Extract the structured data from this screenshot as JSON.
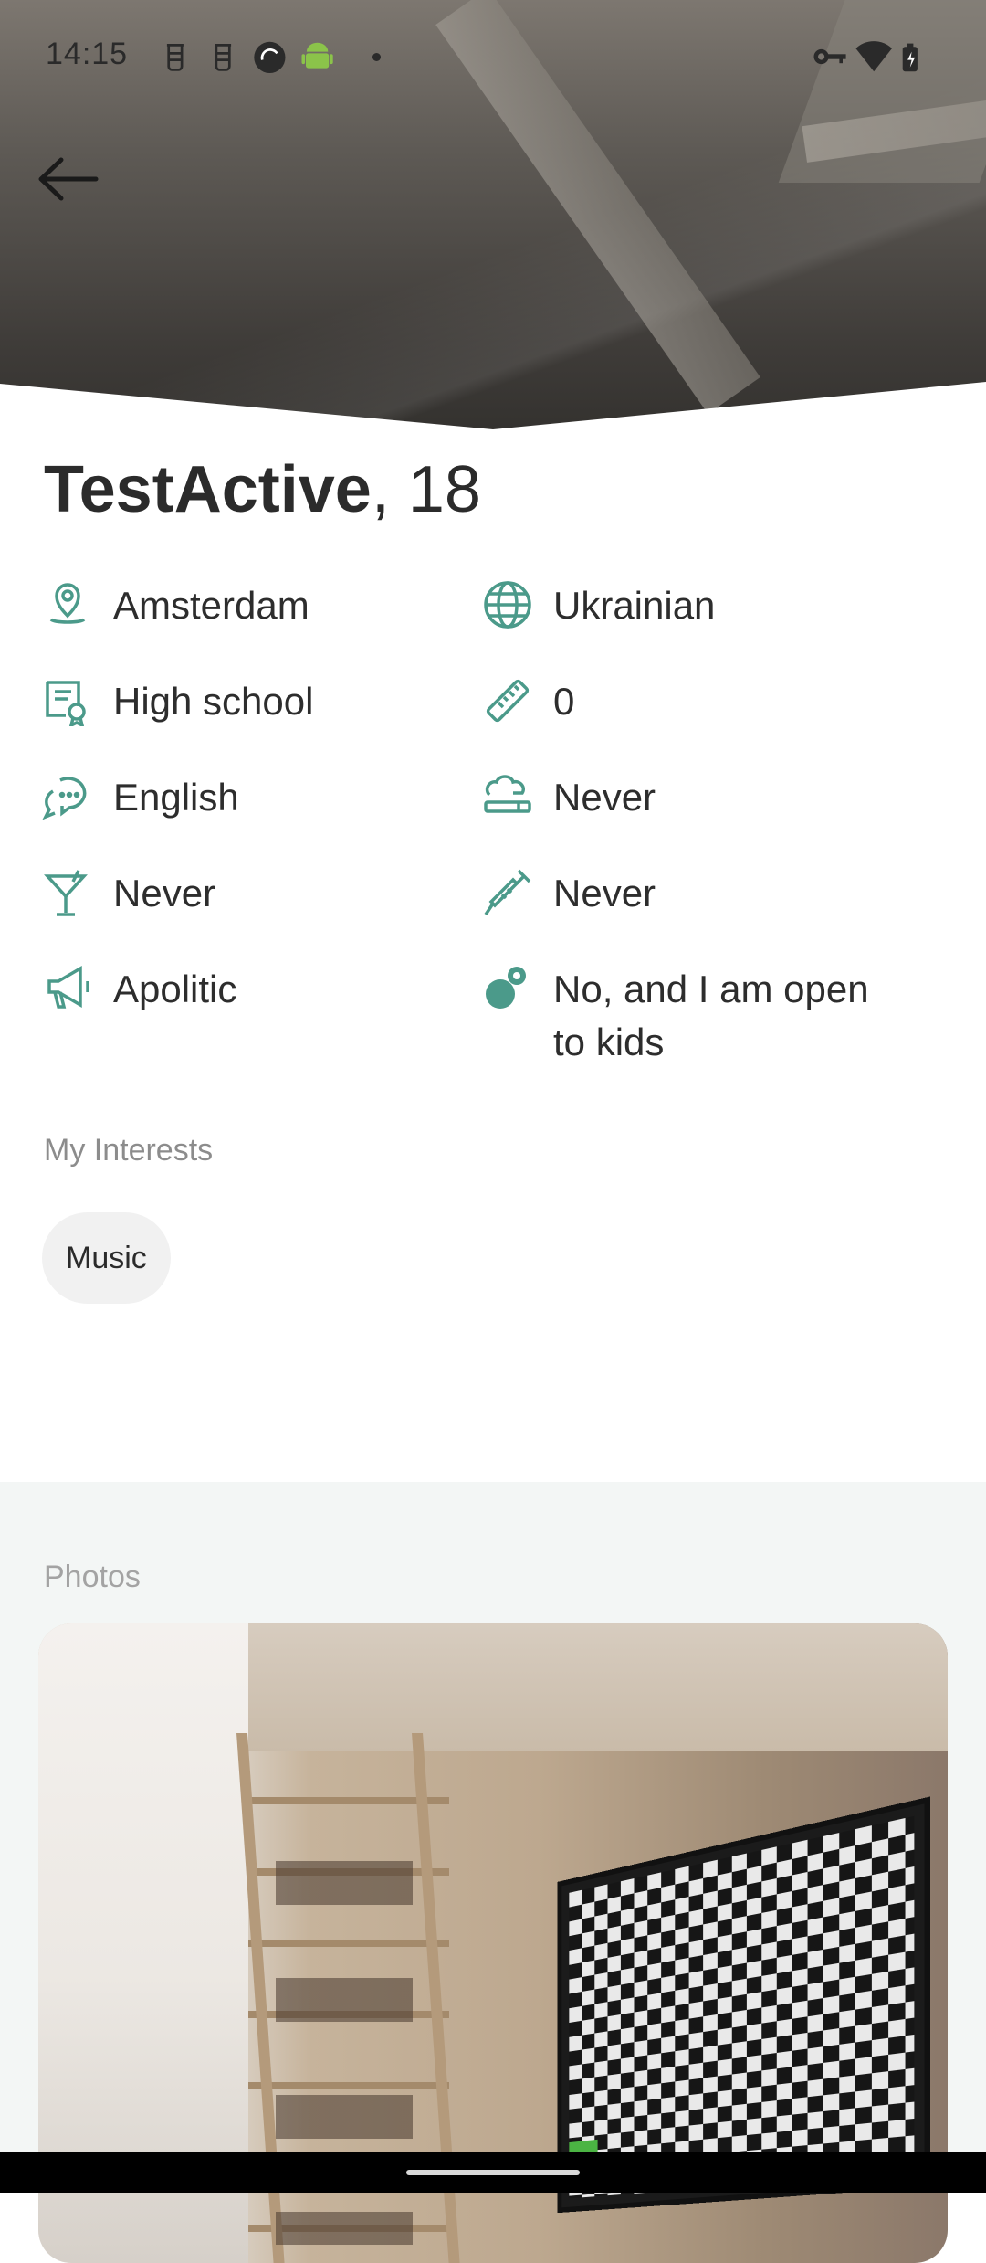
{
  "status_bar": {
    "time": "14:15"
  },
  "profile": {
    "name": "TestActive",
    "age_suffix": ", 18"
  },
  "attributes": [
    {
      "icon": "location-pin-icon",
      "label": "Amsterdam"
    },
    {
      "icon": "globe-icon",
      "label": "Ukrainian"
    },
    {
      "icon": "diploma-icon",
      "label": "High school"
    },
    {
      "icon": "ruler-icon",
      "label": "0"
    },
    {
      "icon": "speech-bubbles-icon",
      "label": "English"
    },
    {
      "icon": "smoking-icon",
      "label": "Never"
    },
    {
      "icon": "cocktail-icon",
      "label": "Never"
    },
    {
      "icon": "syringe-icon",
      "label": "Never"
    },
    {
      "icon": "megaphone-icon",
      "label": "Apolitic"
    },
    {
      "icon": "pacifier-icon",
      "label": "No, and I am open to kids"
    }
  ],
  "interests": {
    "title": "My Interests",
    "items": [
      "Music"
    ]
  },
  "photos": {
    "title": "Photos"
  },
  "colors": {
    "accent": "#4b9a8a",
    "chip_bg": "#f1f1f1",
    "photos_bg": "#f3f6f5"
  }
}
